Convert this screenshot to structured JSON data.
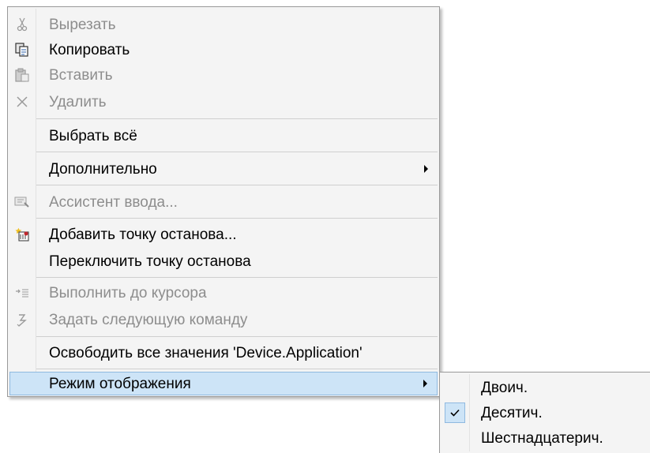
{
  "context_menu": {
    "items": [
      {
        "label": "Вырезать",
        "icon": "scissors-icon",
        "enabled": false
      },
      {
        "label": "Копировать",
        "icon": "copy-icon",
        "enabled": true
      },
      {
        "label": "Вставить",
        "icon": "paste-icon",
        "enabled": false
      },
      {
        "label": "Удалить",
        "icon": "delete-x-icon",
        "enabled": false
      },
      {
        "label": "Выбрать всё",
        "enabled": true
      },
      {
        "label": "Дополнительно",
        "enabled": true,
        "has_submenu": true
      },
      {
        "label": "Ассистент ввода...",
        "icon": "input-assistant-icon",
        "enabled": false
      },
      {
        "label": "Добавить точку останова...",
        "icon": "add-breakpoint-icon",
        "enabled": true
      },
      {
        "label": "Переключить точку останова",
        "enabled": true
      },
      {
        "label": "Выполнить до курсора",
        "icon": "run-to-cursor-icon",
        "enabled": false
      },
      {
        "label": "Задать следующую команду",
        "icon": "set-next-statement-icon",
        "enabled": false
      },
      {
        "label": "Освободить все значения 'Device.Application'",
        "enabled": true
      },
      {
        "label": "Режим отображения",
        "enabled": true,
        "has_submenu": true,
        "highlighted": true
      }
    ]
  },
  "display_mode_submenu": {
    "items": [
      {
        "label": "Двоич.",
        "checked": false
      },
      {
        "label": "Десятич.",
        "checked": true
      },
      {
        "label": "Шестнадцатерич.",
        "checked": false
      }
    ]
  },
  "colors": {
    "menu_bg": "#f4f4f4",
    "highlight_bg": "#cde4f7",
    "highlight_border": "#8fb9e0",
    "disabled_text": "#8d8d8d"
  }
}
